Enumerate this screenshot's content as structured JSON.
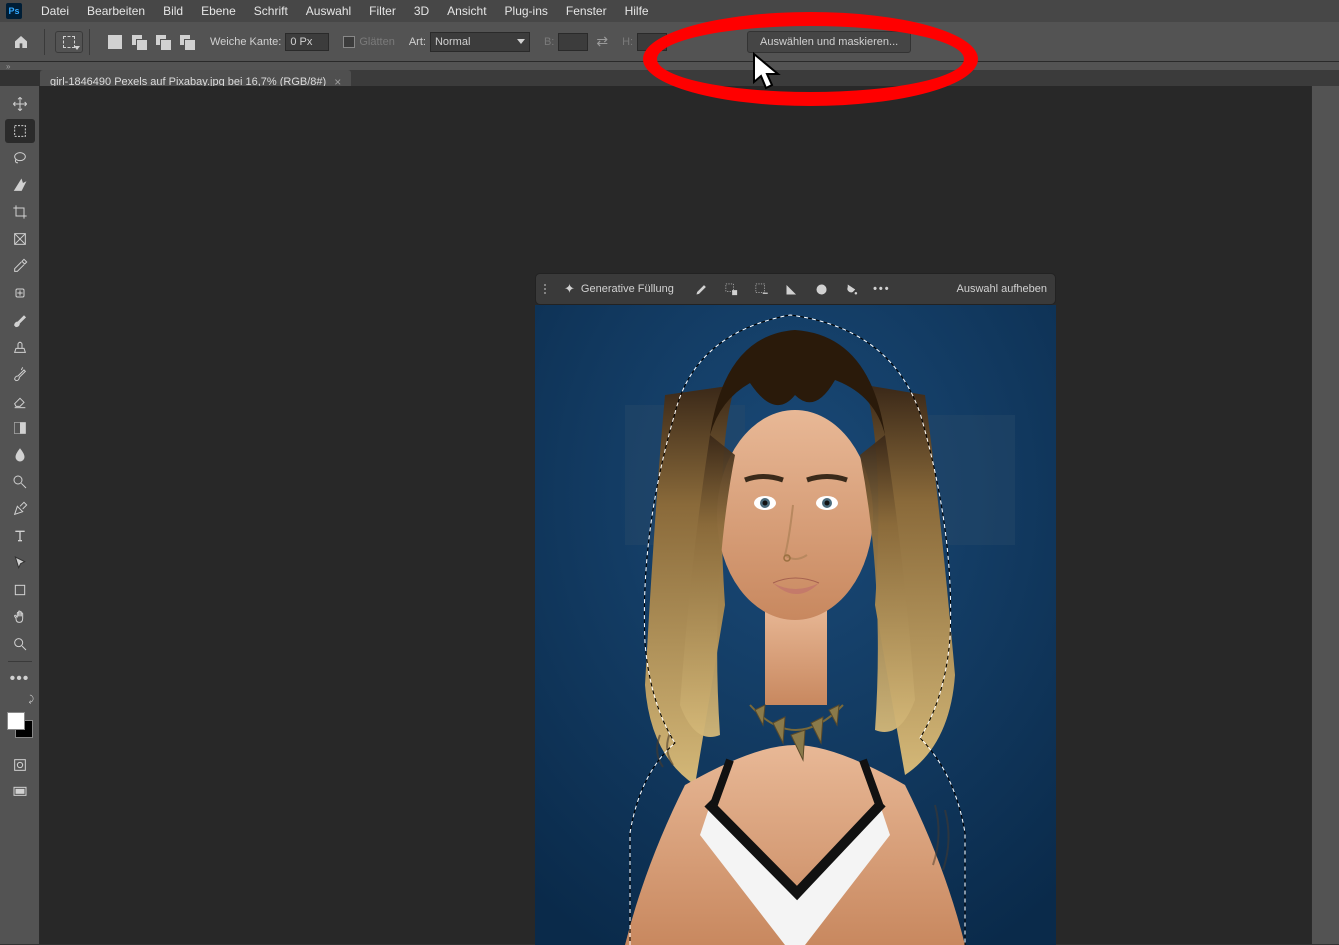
{
  "app_logo": "Ps",
  "menu": [
    "Datei",
    "Bearbeiten",
    "Bild",
    "Ebene",
    "Schrift",
    "Auswahl",
    "Filter",
    "3D",
    "Ansicht",
    "Plug-ins",
    "Fenster",
    "Hilfe"
  ],
  "options": {
    "weiche_kante_label": "Weiche Kante:",
    "weiche_kante_value": "0 Px",
    "glaetten_label": "Glätten",
    "art_label": "Art:",
    "art_value": "Normal",
    "b_label": "B:",
    "h_label": "H:",
    "mask_button": "Auswählen und maskieren..."
  },
  "tab": {
    "title": "girl-1846490 Pexels auf Pixabay.jpg bei 16,7% (RGB/8#)"
  },
  "contextual": {
    "gen_fill": "Generative Füllung",
    "deselect": "Auswahl aufheben"
  },
  "colors": {
    "menubar": "#474747",
    "optbar": "#535353",
    "canvas": "#282828",
    "accent": "#31a8ff",
    "highlight": "#ff0000"
  }
}
